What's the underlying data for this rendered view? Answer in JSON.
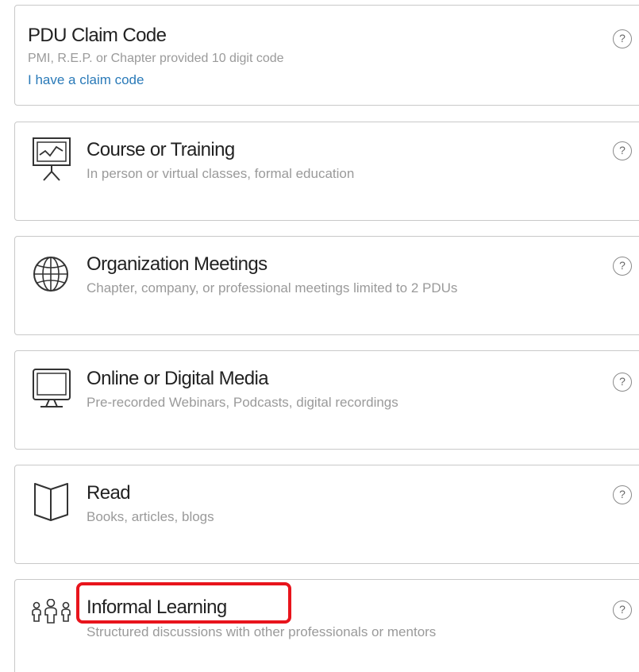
{
  "cards": [
    {
      "title": "PDU Claim Code",
      "subtitle": "PMI, R.E.P. or Chapter provided 10 digit code",
      "link": "I have a claim code",
      "help": "?"
    },
    {
      "title": "Course or Training",
      "subtitle": "In person or virtual classes, formal education",
      "icon": "presentation-board-icon",
      "help": "?"
    },
    {
      "title": "Organization Meetings",
      "subtitle": "Chapter, company, or professional meetings limited to 2 PDUs",
      "icon": "globe-icon",
      "help": "?"
    },
    {
      "title": "Online or Digital Media",
      "subtitle": "Pre-recorded Webinars, Podcasts, digital recordings",
      "icon": "monitor-icon",
      "help": "?"
    },
    {
      "title": "Read",
      "subtitle": "Books, articles, blogs",
      "icon": "open-book-icon",
      "help": "?"
    },
    {
      "title": "Informal Learning",
      "subtitle": "Structured discussions with other professionals or mentors",
      "icon": "people-group-icon",
      "help": "?"
    }
  ],
  "highlight_color": "#e8141c",
  "link_color": "#2a7ab8"
}
